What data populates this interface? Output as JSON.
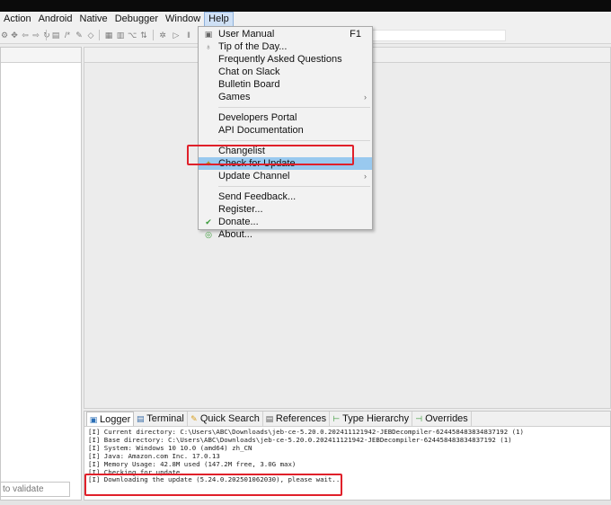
{
  "menubar": {
    "items": [
      "Action",
      "Android",
      "Native",
      "Debugger",
      "Window",
      "Help"
    ],
    "active": "Help"
  },
  "help_menu": {
    "items": [
      {
        "label": "User Manual",
        "shortcut": "F1",
        "icon": "book-icon"
      },
      {
        "label": "Tip of the Day...",
        "icon": "lightbulb-icon"
      },
      {
        "label": "Frequently Asked Questions"
      },
      {
        "label": "Chat on Slack"
      },
      {
        "label": "Bulletin Board"
      },
      {
        "label": "Games",
        "submenu": true
      },
      {
        "separator": true
      },
      {
        "label": "Developers Portal"
      },
      {
        "label": "API Documentation"
      },
      {
        "separator": true
      },
      {
        "label": "Changelist"
      },
      {
        "label": "Check for Update",
        "icon": "update-icon",
        "highlighted": true
      },
      {
        "label": "Update Channel",
        "submenu": true
      },
      {
        "separator": true
      },
      {
        "label": "Send Feedback..."
      },
      {
        "label": "Register..."
      },
      {
        "label": "Donate...",
        "icon": "donate-icon"
      },
      {
        "label": "About...",
        "icon": "about-icon"
      }
    ]
  },
  "left_panel": {
    "filter_text": "to validate"
  },
  "bottom_panel": {
    "tabs": [
      {
        "label": "Logger",
        "icon": "logger-icon",
        "active": true
      },
      {
        "label": "Terminal",
        "icon": "terminal-icon"
      },
      {
        "label": "Quick Search",
        "icon": "quick-search-icon"
      },
      {
        "label": "References",
        "icon": "references-icon"
      },
      {
        "label": "Type Hierarchy",
        "icon": "type-hierarchy-icon"
      },
      {
        "label": "Overrides",
        "icon": "overrides-icon"
      }
    ],
    "log_lines": [
      "[I] Current directory: C:\\Users\\ABC\\Downloads\\jeb-ce-5.20.0.202411121942-JEBDecompiler-624458483834837192 (1)",
      "[I] Base directory: C:\\Users\\ABC\\Downloads\\jeb-ce-5.20.0.202411121942-JEBDecompiler-624458483834837192 (1)",
      "[I] System: Windows 10 10.0 (amd64) zh_CN",
      "[I] Java: Amazon.com Inc. 17.0.13",
      "[I] Memory Usage: 42.8M used (147.2M free, 3.0G max)",
      "[I] Checking for update...",
      "[I] Downloading the update (5.24.0.202501062030), please wait..."
    ]
  },
  "colors": {
    "highlight": "#99c9ef",
    "annotation": "#e0202a"
  }
}
